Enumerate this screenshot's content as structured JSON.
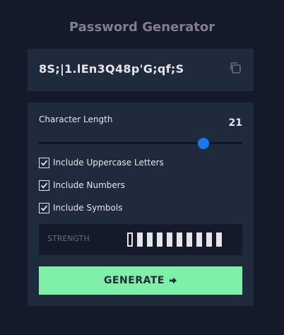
{
  "app": {
    "title": "Password Generator"
  },
  "password": {
    "value": "8S;|1.lEn3Q48p'G;qf;S",
    "copy_icon": "copy-icon"
  },
  "length": {
    "label": "Character Length",
    "value": "21",
    "min": 0,
    "max": 26
  },
  "options": [
    {
      "label": "Include Uppercase Letters",
      "checked": true
    },
    {
      "label": "Include Numbers",
      "checked": true
    },
    {
      "label": "Include Symbols",
      "checked": true
    }
  ],
  "strength": {
    "label": "STRENGTH",
    "bars_total": 10,
    "bars_filled": 9,
    "first_bar_empty": true
  },
  "generate": {
    "label": "GENERATE",
    "icon": "arrow-right-icon"
  },
  "colors": {
    "background": "#141a29",
    "panel": "#1f2a3d",
    "title": "#817d92",
    "accent": "#7ef0a7",
    "slider_thumb": "#1877f2"
  }
}
